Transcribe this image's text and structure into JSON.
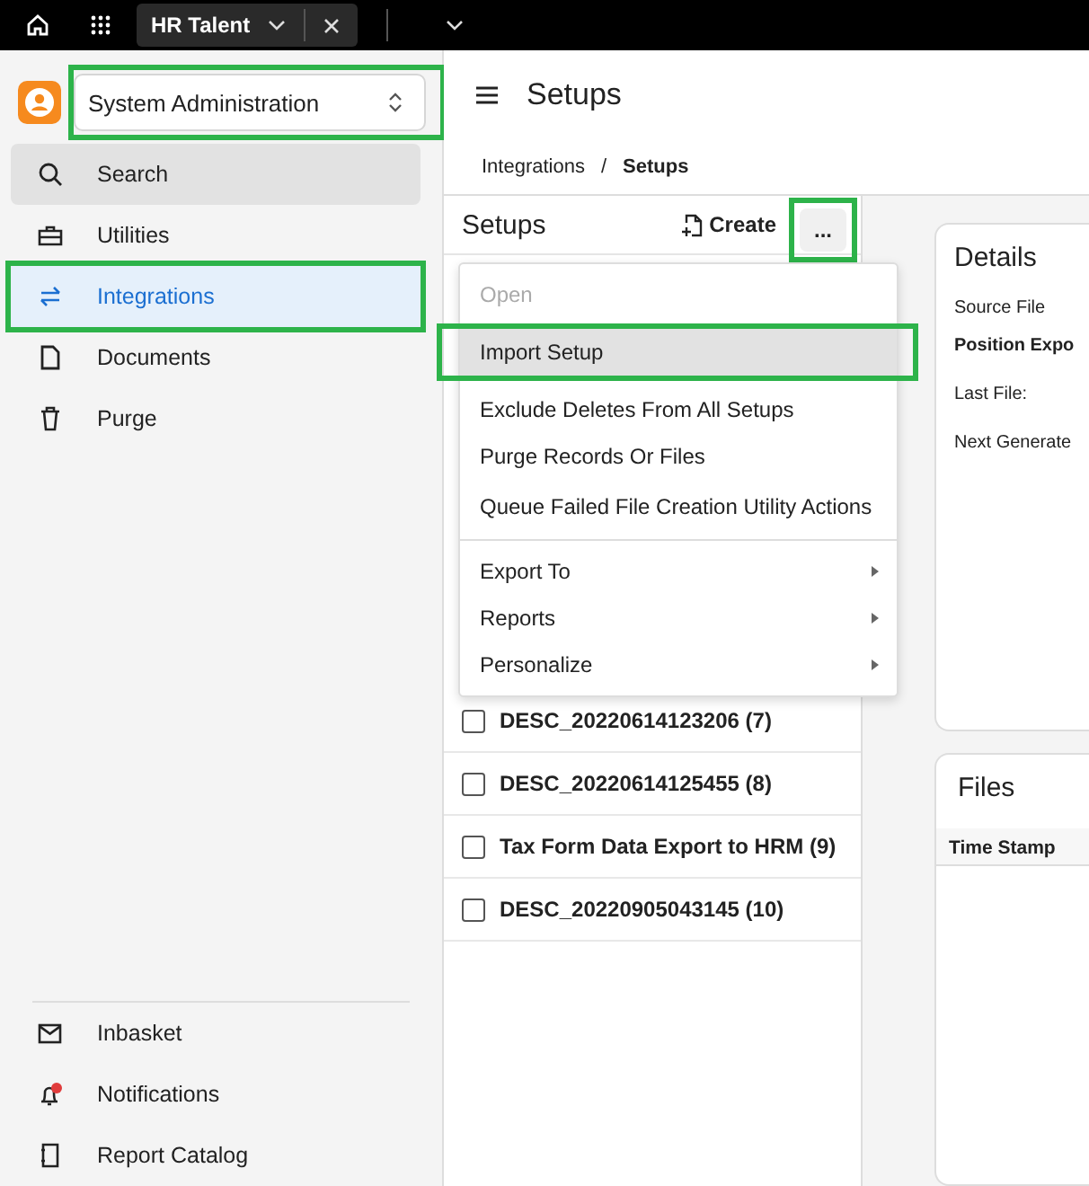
{
  "top_bar": {
    "tab": {
      "title": "HR Talent",
      "selected": true
    }
  },
  "sidebar": {
    "app_selector": {
      "value": "System Administration",
      "highlighted": true
    },
    "items": [
      {
        "label": "Search",
        "selected": false,
        "hovered": true,
        "highlighted": false
      },
      {
        "label": "Utilities",
        "selected": false,
        "hovered": false,
        "highlighted": false
      },
      {
        "label": "Integrations",
        "selected": true,
        "hovered": false,
        "highlighted": true
      },
      {
        "label": "Documents",
        "selected": false,
        "hovered": false,
        "highlighted": false
      },
      {
        "label": "Purge",
        "selected": false,
        "hovered": false,
        "highlighted": false
      }
    ],
    "bottom_items": [
      {
        "label": "Inbasket",
        "badge": false
      },
      {
        "label": "Notifications",
        "badge": true
      },
      {
        "label": "Report Catalog",
        "badge": false
      }
    ]
  },
  "page_title": "Setups",
  "breadcrumb": {
    "separator": "/",
    "items": [
      {
        "label": "Integrations",
        "current": false
      },
      {
        "label": "Setups",
        "current": true
      }
    ]
  },
  "setups_panel": {
    "title": "Setups",
    "create_button": "Create",
    "more_button": {
      "label": "...",
      "highlighted": true
    },
    "rows": [
      {
        "name": "DESC_20220614123206 (7)",
        "checked": false
      },
      {
        "name": "DESC_20220614125455 (8)",
        "checked": false
      },
      {
        "name": "Tax Form Data Export to HRM (9)",
        "checked": false
      },
      {
        "name": "DESC_20220905043145 (10)",
        "checked": false
      }
    ]
  },
  "menu": {
    "items": [
      {
        "label": "Open",
        "disabled": true,
        "hovered": false,
        "submenu": false,
        "highlighted": false,
        "divider_after": false
      },
      {
        "label": "Import Setup",
        "disabled": false,
        "hovered": true,
        "submenu": false,
        "highlighted": true,
        "divider_after": false
      },
      {
        "label": "Exclude Deletes From All Setups",
        "disabled": false,
        "hovered": false,
        "submenu": false,
        "highlighted": false,
        "divider_after": false
      },
      {
        "label": "Purge Records Or Files",
        "disabled": false,
        "hovered": false,
        "submenu": false,
        "highlighted": false,
        "divider_after": false
      },
      {
        "label": "Queue Failed File Creation Utility Actions",
        "disabled": false,
        "hovered": false,
        "submenu": false,
        "highlighted": false,
        "divider_after": true
      },
      {
        "label": "Export To",
        "disabled": false,
        "hovered": false,
        "submenu": true,
        "highlighted": false,
        "divider_after": false
      },
      {
        "label": "Reports",
        "disabled": false,
        "hovered": false,
        "submenu": true,
        "highlighted": false,
        "divider_after": false
      },
      {
        "label": "Personalize",
        "disabled": false,
        "hovered": false,
        "submenu": true,
        "highlighted": false,
        "divider_after": false
      }
    ]
  },
  "details": {
    "title": "Details",
    "fields": [
      {
        "text": "Source File",
        "bold": false
      },
      {
        "text": "Position Expo",
        "bold": true
      },
      {
        "text": "Last File:",
        "bold": false
      },
      {
        "text": "Next Generate",
        "bold": false
      }
    ]
  },
  "files": {
    "title": "Files",
    "columns": [
      "Time Stamp"
    ]
  }
}
